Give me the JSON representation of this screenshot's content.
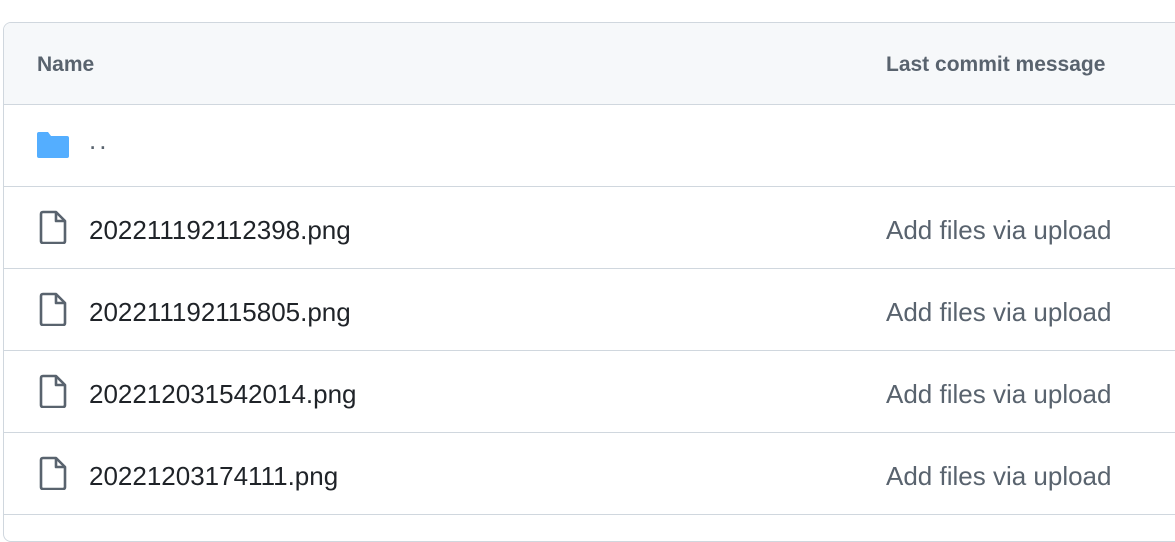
{
  "table": {
    "header": {
      "name_label": "Name",
      "commit_label": "Last commit message"
    },
    "parent_row": {
      "label": "..",
      "icon": "folder-icon",
      "icon_color": "#54aeff"
    },
    "rows": [
      {
        "name": "202211192112398.png",
        "commit": "Add files via upload",
        "icon": "file-icon"
      },
      {
        "name": "202211192115805.png",
        "commit": "Add files via upload",
        "icon": "file-icon"
      },
      {
        "name": "202212031542014.png",
        "commit": "Add files via upload",
        "icon": "file-icon"
      },
      {
        "name": "20221203174111.png",
        "commit": "Add files via upload",
        "icon": "file-icon"
      }
    ]
  },
  "colors": {
    "border": "#d0d7de",
    "header_bg": "#f6f8fa",
    "text_primary": "#1f2328",
    "text_muted": "#59636e"
  }
}
